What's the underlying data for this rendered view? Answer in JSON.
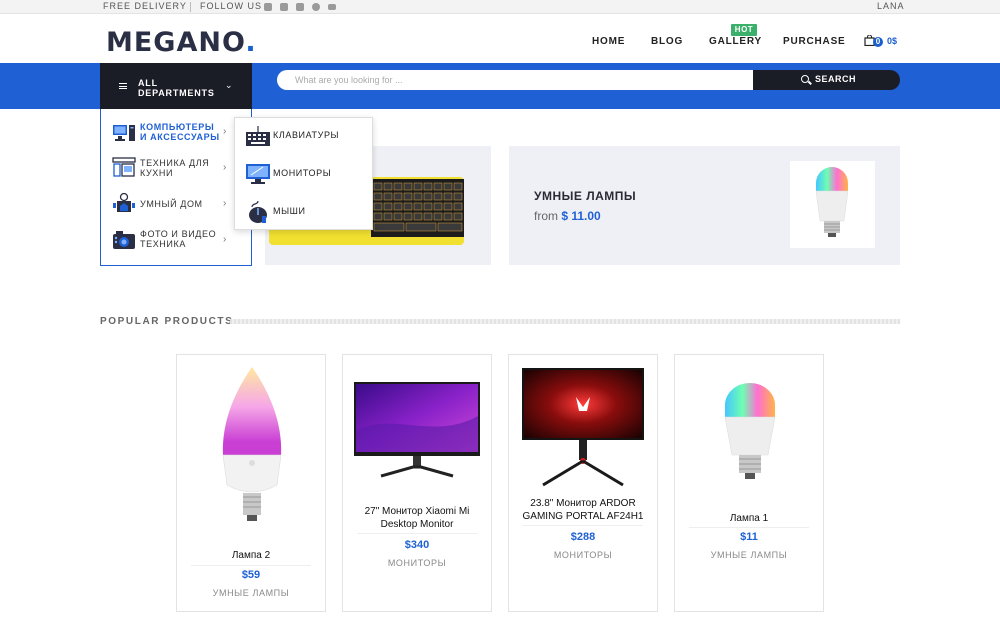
{
  "topbar": {
    "free_delivery": "FREE DELIVERY",
    "follow_us": "FOLLOW US",
    "social_icons": [
      "facebook-icon",
      "twitter-icon",
      "linkedin-icon",
      "pinterest-icon",
      "email-icon"
    ],
    "user": "LANA"
  },
  "header": {
    "logo_main": "MEGANO",
    "logo_dot": ".",
    "nav": [
      "HOME",
      "BLOG",
      "GALLERY",
      "PURCHASE"
    ],
    "hot_badge": "HOT",
    "cart_count": "0",
    "cart_total": "0$"
  },
  "search": {
    "departments_line1": "ALL",
    "departments_line2": "DEPARTMENTS",
    "placeholder": "What are you looking for ...",
    "button": "SEARCH"
  },
  "categories": [
    {
      "line1": "КОМПЬЮТЕРЫ",
      "line2": "И АКСЕССУАРЫ",
      "icon": "computer-icon",
      "active": true
    },
    {
      "line1": "ТЕХНИКА ДЛЯ",
      "line2": "КУХНИ",
      "icon": "kitchen-icon",
      "active": false
    },
    {
      "line1": "УМНЫЙ ДОМ",
      "line2": "",
      "icon": "smart-home-icon",
      "active": false
    },
    {
      "line1": "ФОТО И ВИДЕО",
      "line2": "ТЕХНИКА",
      "icon": "camera-icon",
      "active": false
    }
  ],
  "submenu": [
    {
      "label": "КЛАВИАТУРЫ",
      "icon": "keyboard-icon"
    },
    {
      "label": "МОНИТОРЫ",
      "icon": "monitor-icon"
    },
    {
      "label": "МЫШИ",
      "icon": "mouse-icon"
    }
  ],
  "banners": {
    "smart_lamps_title": "УМНЫЕ ЛАМПЫ",
    "smart_lamps_from": "from",
    "smart_lamps_price": "$ 11.00"
  },
  "popular": {
    "heading": "POPULAR PRODUCTS",
    "products": [
      {
        "name": "Лампа 2",
        "price": "$59",
        "category": "УМНЫЕ ЛАМПЫ"
      },
      {
        "name": "27\" Монитор Xiaomi Mi Desktop Monitor",
        "price": "$340",
        "category": "МОНИТОРЫ"
      },
      {
        "name": "23.8\" Монитор ARDOR GAMING PORTAL AF24H1",
        "price": "$288",
        "category": "МОНИТОРЫ"
      },
      {
        "name": "Лампа 1",
        "price": "$11",
        "category": "УМНЫЕ ЛАМПЫ"
      }
    ]
  },
  "colors": {
    "accent": "#1f61d4",
    "dark": "#1a1c26",
    "hot": "#3bb06a"
  }
}
